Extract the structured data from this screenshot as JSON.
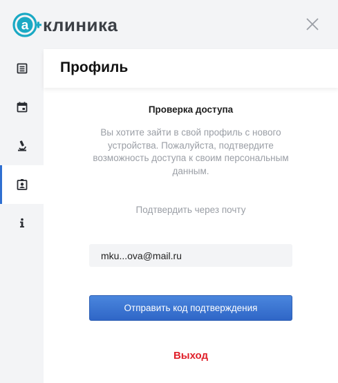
{
  "header": {
    "logo_text": "клиника",
    "logo_letter": "а",
    "brand_color": "#1aa9c4"
  },
  "sidebar": {
    "items": [
      {
        "name": "records-icon"
      },
      {
        "name": "calendar-icon"
      },
      {
        "name": "microscope-icon"
      },
      {
        "name": "profile-badge-icon",
        "active": true
      },
      {
        "name": "info-icon"
      }
    ]
  },
  "main": {
    "title": "Профиль",
    "section_title": "Проверка доступа",
    "description": "Вы хотите зайти в свой профиль с нового устройства. Пожалуйста, подтвердите возможность доступа к своим персональным данным.",
    "method_label": "Подтвердить через почту",
    "email_value": "mku...ova@mail.ru",
    "send_button": "Отправить код подтверждения",
    "logout": "Выход"
  },
  "colors": {
    "accent": "#2f6fd1",
    "logout": "#e0202a",
    "muted_text": "#9a9ea5"
  }
}
